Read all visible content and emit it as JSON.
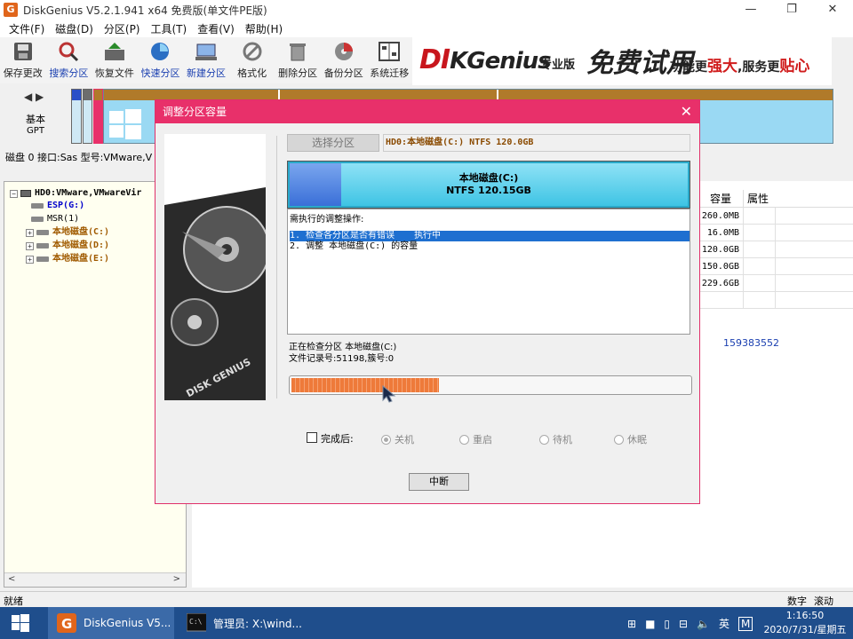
{
  "window": {
    "title": "DiskGenius V5.2.1.941 x64 免费版(单文件PE版)",
    "app_icon_letter": "G",
    "controls": [
      "—",
      "❐",
      "✕"
    ]
  },
  "menu": [
    "文件(F)",
    "磁盘(D)",
    "分区(P)",
    "工具(T)",
    "查看(V)",
    "帮助(H)"
  ],
  "toolbar": [
    {
      "label": "保存更改",
      "icon": "save-icon"
    },
    {
      "label": "搜索分区",
      "icon": "search-icon"
    },
    {
      "label": "恢复文件",
      "icon": "recover-icon"
    },
    {
      "label": "快速分区",
      "icon": "quick-partition-icon"
    },
    {
      "label": "新建分区",
      "icon": "new-partition-icon"
    },
    {
      "label": "格式化",
      "icon": "format-icon"
    },
    {
      "label": "删除分区",
      "icon": "delete-icon"
    },
    {
      "label": "备份分区",
      "icon": "backup-icon"
    },
    {
      "label": "系统迁移",
      "icon": "migrate-icon"
    }
  ],
  "banner": {
    "logo_main": "DI",
    "logo_k": "KGenius",
    "edition": "专业版",
    "trial": "免费试用",
    "slogan_a": "功能更",
    "slogan_strong": "强大",
    "slogan_b": ",服务更",
    "slogan_close": "贴心"
  },
  "disk_map": {
    "nav": "◀ ▶",
    "type_top": "基本",
    "type_bottom": "GPT"
  },
  "disk_info": "磁盘 0 接口:Sas  型号:VMware,V",
  "tree": {
    "disk": "HD0:VMware,VMwareVir",
    "items": [
      {
        "label": "ESP(G:)",
        "style": "blue"
      },
      {
        "label": "MSR(1)",
        "style": "black"
      },
      {
        "label": "本地磁盘(C:)",
        "style": "brown"
      },
      {
        "label": "本地磁盘(D:)",
        "style": "brown"
      },
      {
        "label": "本地磁盘(E:)",
        "style": "brown"
      }
    ]
  },
  "table": {
    "headers": [
      "容量",
      "属性"
    ],
    "capacities": [
      "260.0MB",
      "16.0MB",
      "120.0GB",
      "150.0GB",
      "229.6GB"
    ]
  },
  "sector_value": "159383552",
  "statusbar": {
    "left": "就绪",
    "num": "数字",
    "scroll": "滚动"
  },
  "taskbar": {
    "apps": [
      {
        "label": "DiskGenius V5...",
        "active": true
      },
      {
        "label": "管理员: X:\\wind...",
        "active": false
      }
    ],
    "tray_lang": "英",
    "tray_ime": "M",
    "time": "1:16:50",
    "date": "2020/7/31/星期五"
  },
  "dialog": {
    "title": "调整分区容量",
    "select_button": "选择分区",
    "selected_partition": "HD0:本地磁盘(C:) NTFS 120.0GB",
    "partition_name": "本地磁盘(C:)",
    "partition_size": "NTFS 120.15GB",
    "ops_header": "需执行的调整操作:",
    "operations": [
      {
        "text": "1. 检查各分区是否有错误",
        "status": "执行中"
      },
      {
        "text": "2. 调整 本地磁盘(C:) 的容量",
        "status": ""
      }
    ],
    "checking": "正在检查分区 本地磁盘(C:)",
    "record_info": "文件记录号:51198,簇号:0",
    "progress": 0.37,
    "after_label": "完成后:",
    "after_options": [
      {
        "label": "关机",
        "selected": true
      },
      {
        "label": "重启",
        "selected": false
      },
      {
        "label": "待机",
        "selected": false
      },
      {
        "label": "休眠",
        "selected": false
      }
    ],
    "abort_button": "中断",
    "disk_art_text": "DISK GENIUS"
  }
}
